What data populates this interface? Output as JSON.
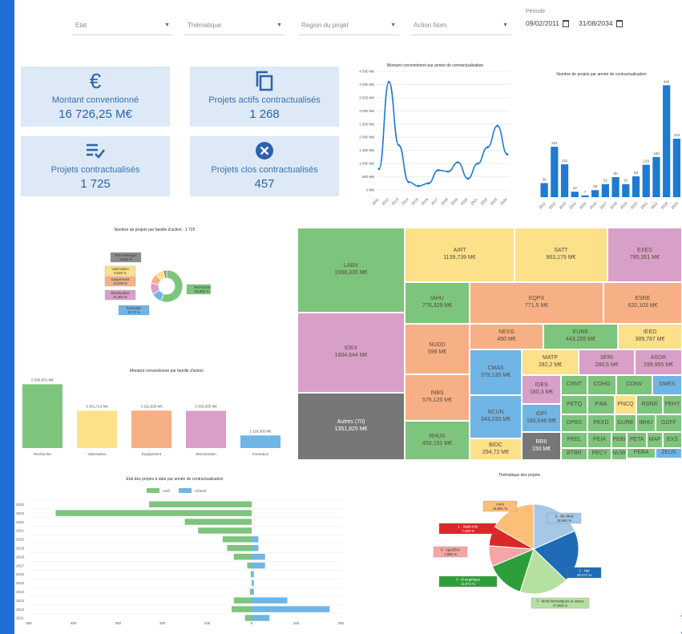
{
  "filters": {
    "etat": "Etat",
    "thematique": "Thématique",
    "region": "Region du projet",
    "action": "Action Nom",
    "periode_label": "Période",
    "date_start": "09/02/2011",
    "date_end": "31/08/2034"
  },
  "kpis": [
    {
      "label": "Montant conventionné",
      "value": "16 726,25 M€",
      "icon": "euro-icon"
    },
    {
      "label": "Projets actifs contractualisés",
      "value": "1 268",
      "icon": "copy-icon"
    },
    {
      "label": "Projets contractualisés",
      "value": "1 725",
      "icon": "checklist-icon"
    },
    {
      "label": "Projets clos contractualisés",
      "value": "457",
      "icon": "close-circle-icon"
    }
  ],
  "charts": {
    "line_title": "Montant conventionné par année de contractualisation",
    "bar_years_title": "Nombre de projets par année de contractualisation",
    "donut_title": "Nombre de projets par famille d'action : 1 725",
    "bar_family_title": "Montant conventionné par famille d'action",
    "diverging_title": "Etat des projets à date par année de contractualisation",
    "pie_title": "Thématique des projets"
  },
  "chart_data": [
    {
      "type": "line",
      "title": "Montant conventionné par année de contractualisation",
      "x": [
        "2011",
        "2012",
        "2013",
        "2014",
        "2015",
        "2016",
        "2017",
        "2018",
        "2019",
        "2020",
        "2021",
        "2022",
        "2023",
        "2024"
      ],
      "values": [
        800,
        4100,
        1700,
        300,
        150,
        250,
        750,
        700,
        1050,
        430,
        1000,
        1620,
        2430,
        1350
      ],
      "yticks": [
        "0 M€",
        "500 M€",
        "1 000 M€",
        "1 500 M€",
        "2 000 M€",
        "2 500 M€",
        "3 000 M€",
        "3 500 M€",
        "4 000 M€",
        "4 500 M€"
      ],
      "ylim": [
        0,
        4500
      ],
      "color": "#1f7ad1"
    },
    {
      "type": "bar",
      "title": "Nombre de projets par année de contractualisation",
      "categories": [
        "2011",
        "2012",
        "2013",
        "2014",
        "2015",
        "2016",
        "2017",
        "2018",
        "2019",
        "2020",
        "2021",
        "2022",
        "2023",
        "2024"
      ],
      "values": [
        56,
        201,
        131,
        22,
        7,
        28,
        52,
        80,
        52,
        83,
        129,
        160,
        446,
        233
      ],
      "labels": [
        "56",
        "201",
        "131",
        "22",
        "7",
        "28",
        "52",
        "80",
        "52",
        "83",
        "129",
        "160",
        "446",
        "233"
      ],
      "color": "#1f7ad1"
    },
    {
      "type": "pie",
      "title": "Nombre de projets par famille d'action : 1 725",
      "slices": [
        {
          "name": "Recherche",
          "pct": "55,856 %",
          "value": 55.856,
          "color": "#7dc47d"
        },
        {
          "name": "Formation",
          "pct": "10,72 %",
          "value": 10.72,
          "color": "#6fb5e6"
        },
        {
          "name": "Structuration",
          "pct": "11,362 %",
          "value": 11.362,
          "color": "#d8a0c8"
        },
        {
          "name": "Equipement",
          "pct": "10,029 %",
          "value": 10.029,
          "color": "#f7b085"
        },
        {
          "name": "Valorisation",
          "pct": "8,638 %",
          "value": 8.638,
          "color": "#fce08a"
        },
        {
          "name": "Non renseigné",
          "pct": "3,345 %",
          "value": 3.345,
          "color": "#8c8c8c"
        }
      ]
    },
    {
      "type": "bar",
      "title": "Montant conventionné par famille d'action",
      "categories": [
        "Recherche",
        "Valorisation",
        "Equipement",
        "Structuration",
        "Formation"
      ],
      "values": [
        5658.851,
        3301.713,
        3322.928,
        3303.305,
        1118.302
      ],
      "labels": [
        "5 658,851 M€",
        "3 301,713 M€",
        "3 322,928 M€",
        "3 303,305 M€",
        "1 118,302 M€"
      ],
      "colors": [
        "#7dc47d",
        "#fce08a",
        "#f7b085",
        "#d8a0c8",
        "#6fb5e6"
      ]
    },
    {
      "type": "bar",
      "title": "Etat des projets à date par année de contractualisation",
      "legend": [
        "Actif",
        "Clôturé"
      ],
      "categories": [
        "2024",
        "2023",
        "2022",
        "2021",
        "2020",
        "2019",
        "2018",
        "2017",
        "2016",
        "2015",
        "2014",
        "2013",
        "2012",
        "2011"
      ],
      "actif": [
        -230,
        -440,
        -150,
        -120,
        -65,
        -55,
        -40,
        -10,
        -2,
        0,
        -4,
        -40,
        -45,
        -15
      ],
      "clos": [
        0,
        0,
        0,
        0,
        15,
        15,
        30,
        30,
        5,
        5,
        5,
        80,
        175,
        40
      ],
      "xticks": [
        "500",
        "400",
        "300",
        "200",
        "100",
        "0",
        "100",
        "200"
      ],
      "colors": [
        "#7dc47d",
        "#6fb5e6"
      ]
    },
    {
      "type": "pie",
      "title": "Thématique des projets",
      "slices": [
        {
          "name": "5 - Bio Med",
          "pct": "18,681 %",
          "value": 18.681,
          "color": "#a4c8e6"
        },
        {
          "name": "2 - Nat",
          "pct": "19,072 %",
          "value": 19.072,
          "color": "#1f6bb5"
        },
        {
          "name": "7 - Multi-thématiques et autres",
          "pct": "17,984 %",
          "value": 17.984,
          "color": "#b6e0a0"
        },
        {
          "name": "3 - Énergétique",
          "pct": "13,971 %",
          "value": 13.971,
          "color": "#2e9e3a"
        },
        {
          "name": "4 - Agro/Env",
          "pct": "7,586 %",
          "value": 7.586,
          "color": "#f4a6a4"
        },
        {
          "name": "1 - Math-Info",
          "pct": "7,188 %",
          "value": 7.188,
          "color": "#d92828"
        },
        {
          "name": "Autre",
          "pct": "16,991 %",
          "value": 16.991,
          "color": "#fbbf78"
        }
      ]
    }
  ],
  "treemap": [
    {
      "name": "LABX",
      "value": "1698,335 M€",
      "color": "#7dc47d"
    },
    {
      "name": "AIRT",
      "value": "1139,739 M€",
      "color": "#fce08a"
    },
    {
      "name": "SATT",
      "value": "963,179 M€",
      "color": "#fce08a"
    },
    {
      "name": "EXES",
      "value": "785,351 M€",
      "color": "#d8a0c8"
    },
    {
      "name": "IAHU",
      "value": "776,329 M€",
      "color": "#7dc47d"
    },
    {
      "name": "EQPX",
      "value": "771,5 M€",
      "color": "#f7b085"
    },
    {
      "name": "ESRE",
      "value": "620,103 M€",
      "color": "#f7b085"
    },
    {
      "name": "IDEX",
      "value": "1604,644 M€",
      "color": "#d8a0c8"
    },
    {
      "name": "NUDD",
      "value": "599 M€",
      "color": "#f7b085"
    },
    {
      "name": "NEXG",
      "value": "450 M€",
      "color": "#f7b085"
    },
    {
      "name": "EURE",
      "value": "443,255 M€",
      "color": "#7dc47d"
    },
    {
      "name": "IEED",
      "value": "389,787 M€",
      "color": "#fce08a"
    },
    {
      "name": "CMAS",
      "value": "379,135 M€",
      "color": "#6fb5e6"
    },
    {
      "name": "MATP",
      "value": "282,2 M€",
      "color": "#fce08a"
    },
    {
      "name": "SFRI",
      "value": "280,5 M€",
      "color": "#d8a0c8"
    },
    {
      "name": "ASDR",
      "value": "199,955 M€",
      "color": "#d8a0c8"
    },
    {
      "name": "INBS",
      "value": "575,125 M€",
      "color": "#f7b085"
    },
    {
      "name": "IDES",
      "value": "180,3 M€",
      "color": "#d8a0c8"
    },
    {
      "name": "CRNT",
      "value": "",
      "color": "#7dc47d"
    },
    {
      "name": "COHO",
      "value": "",
      "color": "#7dc47d"
    },
    {
      "name": "CONV",
      "value": "",
      "color": "#7dc47d"
    },
    {
      "name": "DMES",
      "value": "",
      "color": "#6fb5e6"
    },
    {
      "name": "NCUN",
      "value": "343,233 M€",
      "color": "#6fb5e6"
    },
    {
      "name": "PETQ",
      "value": "",
      "color": "#7dc47d"
    },
    {
      "name": "P3IA",
      "value": "",
      "color": "#7dc47d"
    },
    {
      "name": "PNCQ",
      "value": "",
      "color": "#fce08a"
    },
    {
      "name": "RSNR",
      "value": "",
      "color": "#7dc47d"
    },
    {
      "name": "PEHY",
      "value": "",
      "color": "#7dc47d"
    },
    {
      "name": "IDFI",
      "value": "180,046 M€",
      "color": "#6fb5e6"
    },
    {
      "name": "DPBS",
      "value": "",
      "color": "#7dc47d"
    },
    {
      "name": "PEXD",
      "value": "",
      "color": "#7dc47d"
    },
    {
      "name": "GURE",
      "value": "",
      "color": "#7dc47d"
    },
    {
      "name": "IBHU",
      "value": "",
      "color": "#7dc47d"
    },
    {
      "name": "GDFF",
      "value": "",
      "color": "#7dc47d"
    },
    {
      "name": "Autres (70)",
      "value": "1351,825 M€",
      "color": "#777777"
    },
    {
      "name": "RHUS",
      "value": "450,191 M€",
      "color": "#7dc47d"
    },
    {
      "name": "BIDC",
      "value": "294,72 M€",
      "color": "#fce08a"
    },
    {
      "name": "PEEL",
      "value": "",
      "color": "#7dc47d"
    },
    {
      "name": "PEIA",
      "value": "",
      "color": "#7dc47d"
    },
    {
      "name": "PEBI",
      "value": "",
      "color": "#7dc47d"
    },
    {
      "name": "PETA",
      "value": "",
      "color": "#7dc47d"
    },
    {
      "name": "MAF",
      "value": "",
      "color": "#7dc47d"
    },
    {
      "name": "EXS",
      "value": "",
      "color": "#7dc47d"
    },
    {
      "name": "RRII",
      "value": "150 M€",
      "color": "#777777"
    },
    {
      "name": "BTBR",
      "value": "",
      "color": "#7dc47d"
    },
    {
      "name": "PECY",
      "value": "",
      "color": "#7dc47d"
    },
    {
      "name": "NUW",
      "value": "",
      "color": "#7dc47d"
    },
    {
      "name": "PEBA",
      "value": "",
      "color": "#7dc47d"
    },
    {
      "name": "ZEUS",
      "value": "",
      "color": "#6fb5e6"
    },
    {
      "name": "CHBS",
      "value": "",
      "color": "#777777"
    },
    {
      "name": "EXTR",
      "value": "",
      "color": "#777777"
    }
  ]
}
